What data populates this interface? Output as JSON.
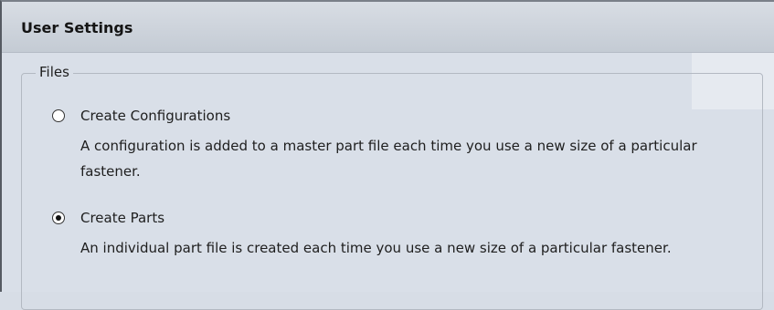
{
  "panel": {
    "title": "User Settings"
  },
  "files_group": {
    "legend": "Files",
    "options": [
      {
        "label": "Create Configurations",
        "description": "A configuration is added to a master part file each time you use a new size of a particular fastener.",
        "selected": false
      },
      {
        "label": "Create Parts",
        "description": "An individual part file is created each time you use a new size of a particular fastener.",
        "selected": true
      }
    ]
  }
}
